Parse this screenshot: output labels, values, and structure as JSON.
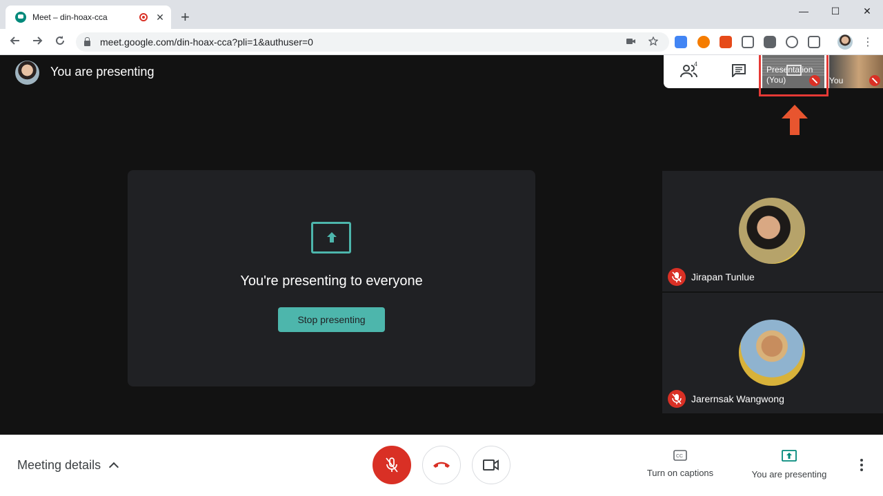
{
  "browser": {
    "tab_title": "Meet – din-hoax-cca",
    "tab_close": "✕",
    "new_tab": "+",
    "url": "meet.google.com/din-hoax-cca?pli=1&authuser=0",
    "window_controls": {
      "minimize": "—",
      "maximize": "☐",
      "close": "✕"
    }
  },
  "header": {
    "presenter_title": "You are presenting"
  },
  "presentation": {
    "message": "You're presenting to everyone",
    "stop_button": "Stop presenting"
  },
  "top_panel": {
    "people_count": "4",
    "presentation_thumb_label_line1": "Presentation",
    "presentation_thumb_label_line2": "(You)",
    "you_thumb_label": "You"
  },
  "participants": [
    {
      "name": "Jirapan Tunlue"
    },
    {
      "name": "Jarernsak Wangwong"
    }
  ],
  "bottom_bar": {
    "meeting_details": "Meeting details",
    "captions_label": "Turn on captions",
    "presenting_label": "You are presenting"
  },
  "colors": {
    "accent_teal": "#4db6ac",
    "mute_red": "#d93025",
    "highlight_red": "#e53935",
    "arrow_orange": "#e8552f"
  }
}
